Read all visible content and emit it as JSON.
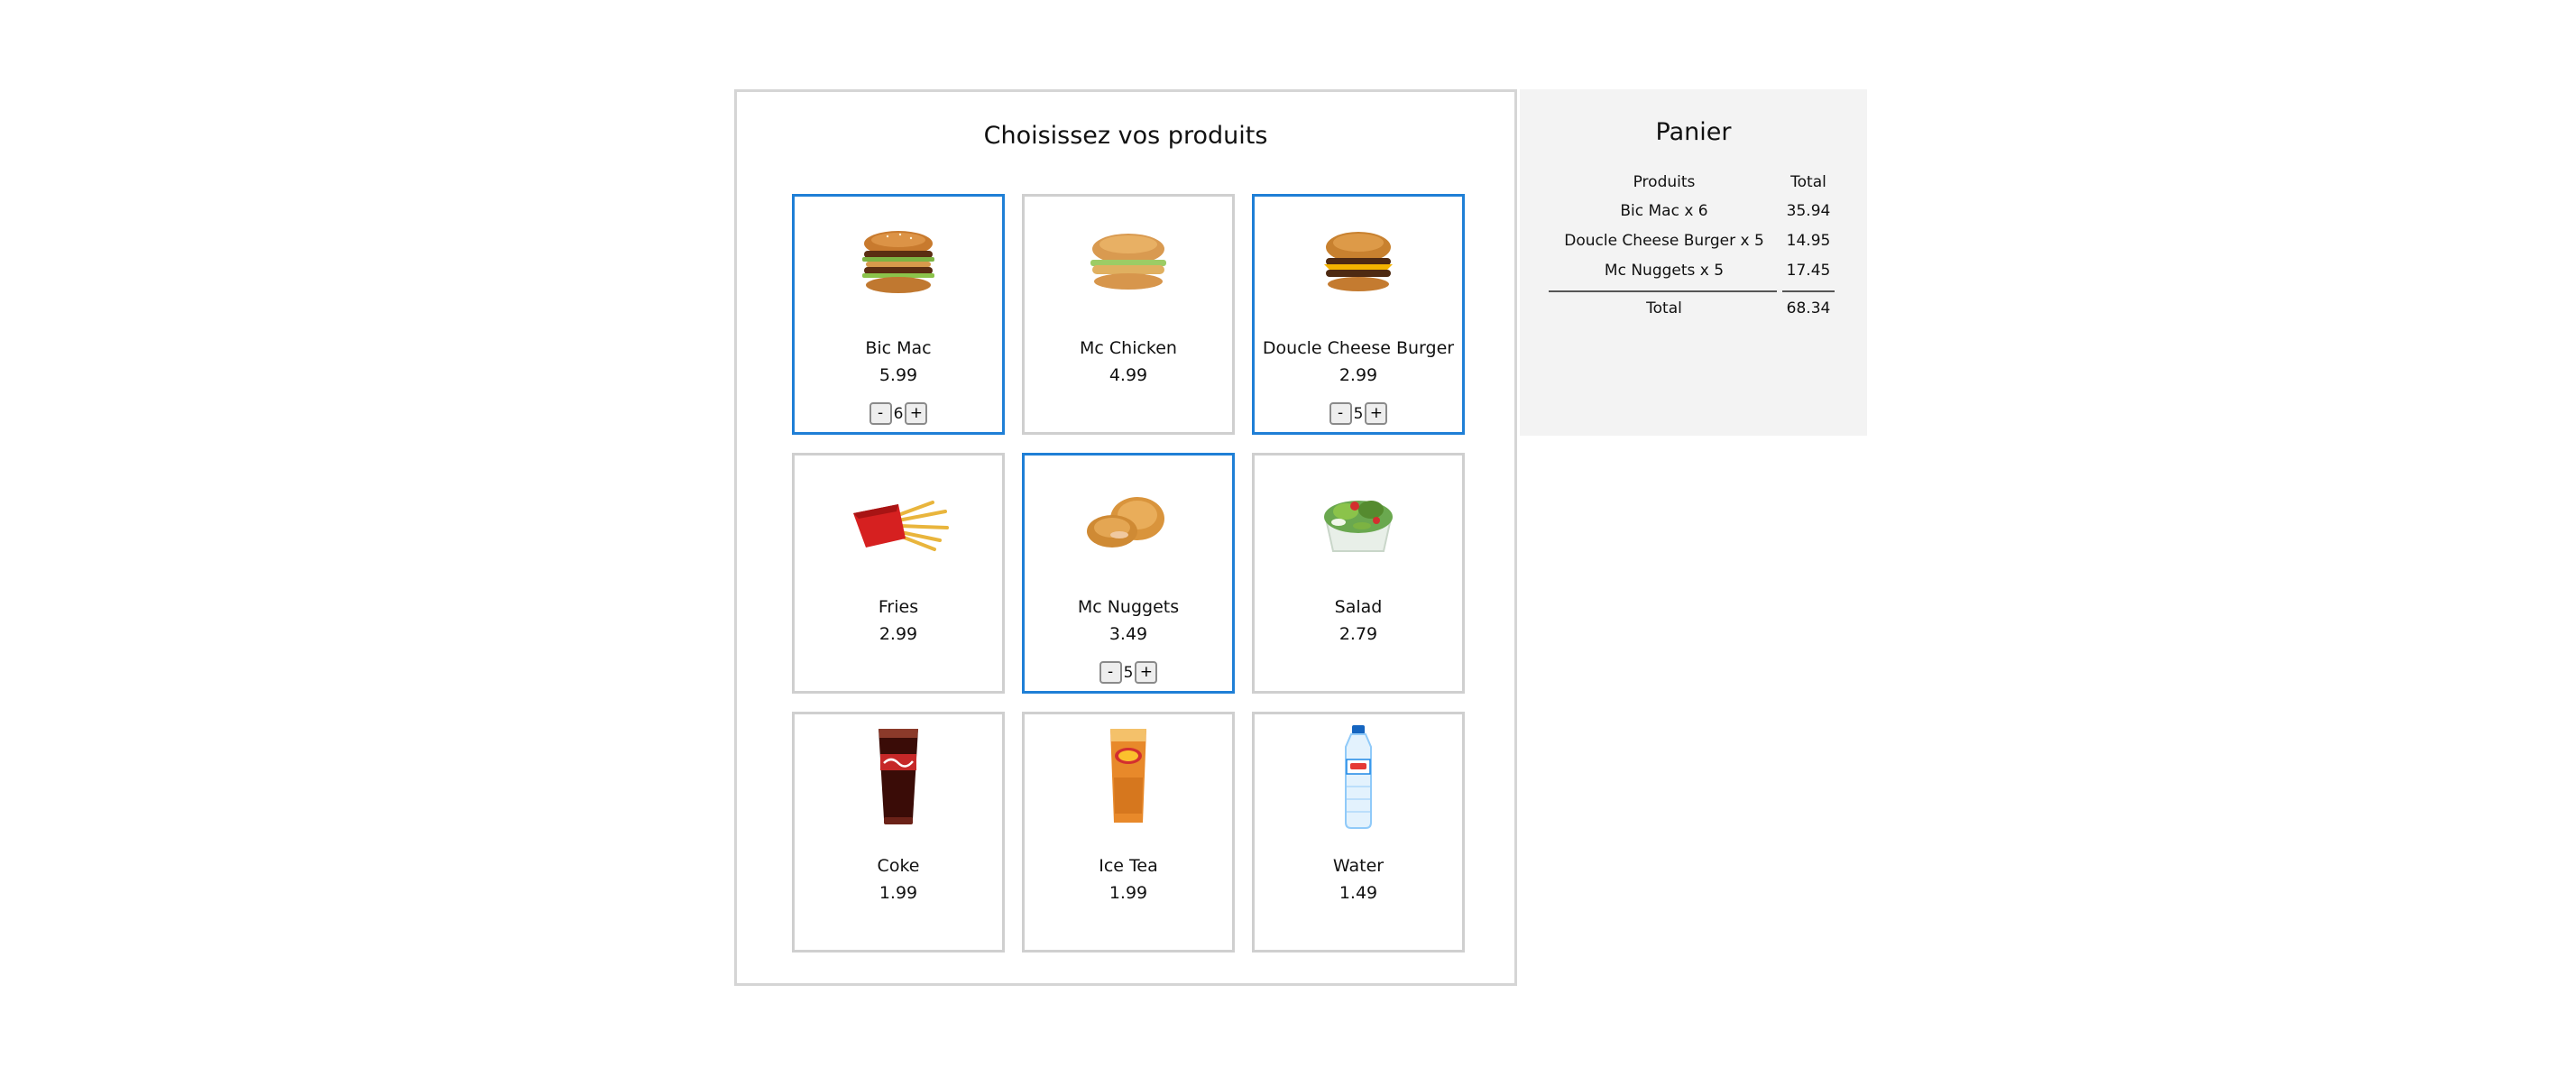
{
  "products_title": "Choisissez vos produits",
  "products": [
    {
      "name": "Bic Mac",
      "price": "5.99",
      "qty": "6",
      "selected": true,
      "icon": "big-mac-burger"
    },
    {
      "name": "Mc Chicken",
      "price": "4.99",
      "qty": null,
      "selected": false,
      "icon": "chicken-burger"
    },
    {
      "name": "Doucle Cheese Burger",
      "price": "2.99",
      "qty": "5",
      "selected": true,
      "icon": "cheeseburger"
    },
    {
      "name": "Fries",
      "price": "2.99",
      "qty": null,
      "selected": false,
      "icon": "fries"
    },
    {
      "name": "Mc Nuggets",
      "price": "3.49",
      "qty": "5",
      "selected": true,
      "icon": "nuggets"
    },
    {
      "name": "Salad",
      "price": "2.79",
      "qty": null,
      "selected": false,
      "icon": "salad-bowl"
    },
    {
      "name": "Coke",
      "price": "1.99",
      "qty": null,
      "selected": false,
      "icon": "coke-glass"
    },
    {
      "name": "Ice Tea",
      "price": "1.99",
      "qty": null,
      "selected": false,
      "icon": "ice-tea-glass"
    },
    {
      "name": "Water",
      "price": "1.49",
      "qty": null,
      "selected": false,
      "icon": "water-bottle"
    }
  ],
  "qty_controls": {
    "minus": "-",
    "plus": "+"
  },
  "cart": {
    "title": "Panier",
    "col_products": "Produits",
    "col_total": "Total",
    "rows": [
      {
        "label": "Bic Mac x 6",
        "total": "35.94"
      },
      {
        "label": "Doucle Cheese Burger x 5",
        "total": "14.95"
      },
      {
        "label": "Mc Nuggets x 5",
        "total": "17.45"
      }
    ],
    "total_label": "Total",
    "total_value": "68.34"
  },
  "colors": {
    "selected_border": "#1f7fd6",
    "card_border": "#cfcfcf",
    "cart_background": "#f3f3f3"
  }
}
